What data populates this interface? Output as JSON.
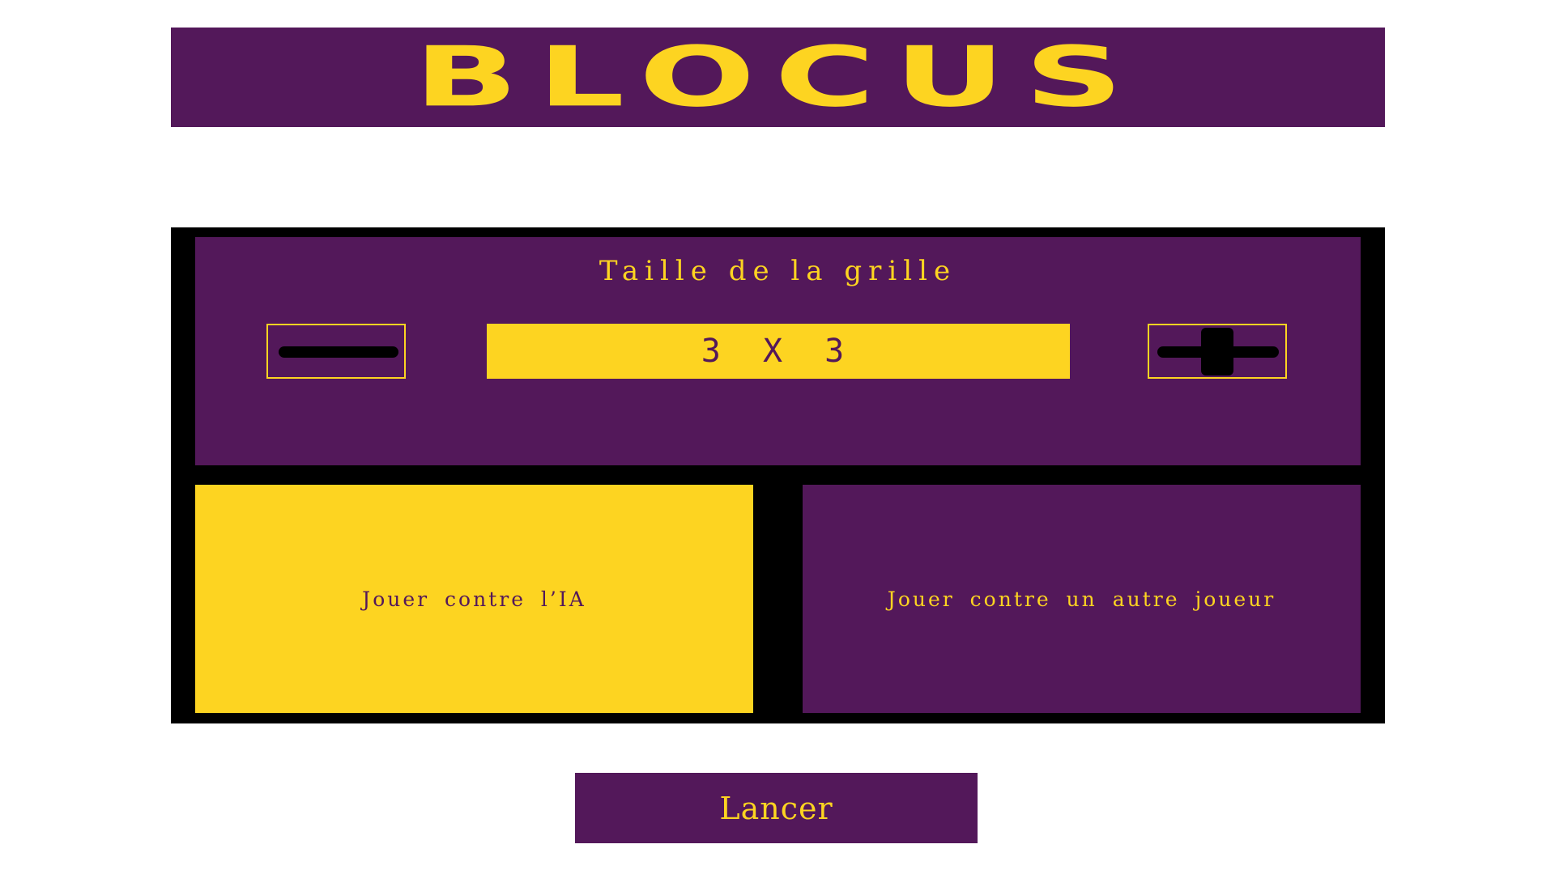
{
  "header": {
    "title": "BLOCUS"
  },
  "grid_size": {
    "label": "Taille de la grille",
    "value": "3 X 3",
    "decrement_icon": "minus-icon",
    "increment_icon": "plus-icon"
  },
  "modes": {
    "vs_ai": {
      "label": "Jouer contre l’IA",
      "selected": true
    },
    "vs_player": {
      "label": "Jouer contre un autre joueur",
      "selected": false
    }
  },
  "launch_button": {
    "label": "Lancer"
  },
  "colors": {
    "purple": "#53185a",
    "yellow": "#fdd421",
    "black": "#000000",
    "background": "#ffffff"
  }
}
